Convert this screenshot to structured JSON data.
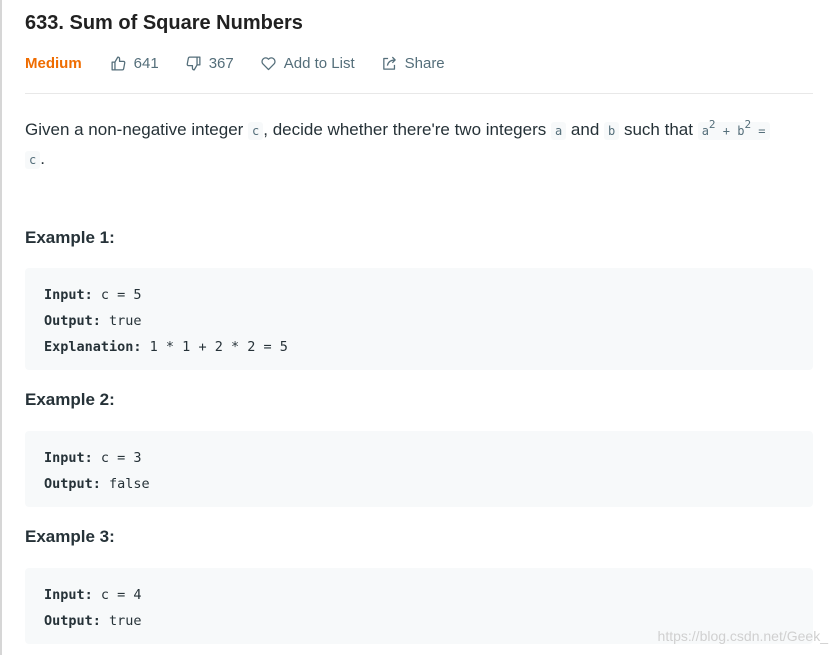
{
  "problem": {
    "title": "633. Sum of Square Numbers",
    "difficulty": "Medium",
    "likes": "641",
    "dislikes": "367",
    "add_to_list": "Add to List",
    "share": "Share"
  },
  "description": {
    "part1": "Given a non-negative integer ",
    "code_c": "c",
    "part2": ", decide whether there're two integers ",
    "code_a": "a",
    "part3": " and ",
    "code_b": "b",
    "part4": " such that ",
    "eq_a": "a",
    "eq_exp1": "2",
    "eq_plus": " + b",
    "eq_exp2": "2",
    "eq_equals": " =",
    "code_c2": "c",
    "end": "."
  },
  "examples": [
    {
      "title": "Example 1:",
      "input_label": "Input:",
      "input_value": " c = 5",
      "output_label": "Output:",
      "output_value": " true",
      "explanation_label": "Explanation:",
      "explanation_value": " 1 * 1 + 2 * 2 = 5"
    },
    {
      "title": "Example 2:",
      "input_label": "Input:",
      "input_value": " c = 3",
      "output_label": "Output:",
      "output_value": " false"
    },
    {
      "title": "Example 3:",
      "input_label": "Input:",
      "input_value": " c = 4",
      "output_label": "Output:",
      "output_value": " true"
    }
  ],
  "watermark": "https://blog.csdn.net/Geek_",
  "colors": {
    "difficulty_medium": "#ef6c00",
    "code_bg": "#f7f9fa",
    "text": "#263238",
    "meta_text": "#546e7a"
  },
  "icons": {
    "like": "thumbs-up-icon",
    "dislike": "thumbs-down-icon",
    "add_to_list": "heart-icon",
    "share": "share-icon"
  }
}
